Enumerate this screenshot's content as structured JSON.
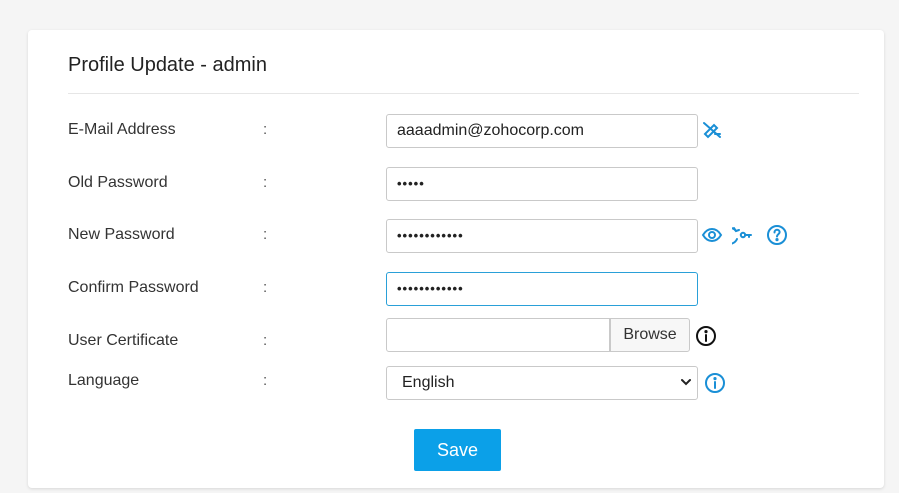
{
  "form": {
    "title": "Profile Update - admin",
    "colon": ":",
    "fields": {
      "email": {
        "label": "E-Mail Address",
        "value": "aaaadmin@zohocorp.com"
      },
      "old_password": {
        "label": "Old Password",
        "value": "•••••"
      },
      "new_password": {
        "label": "New Password",
        "value": "••••••••••••"
      },
      "confirm_password": {
        "label": "Confirm Password",
        "value": "••••••••••••"
      },
      "certificate": {
        "label": "User Certificate",
        "browse_label": "Browse"
      },
      "language": {
        "label": "Language",
        "selected": "English"
      }
    },
    "save_label": "Save"
  },
  "icons": {
    "email_action": "edit-off-icon",
    "show_password": "eye-icon",
    "generate_password": "key-icon",
    "password_help": "help-circle-icon",
    "certificate_info": "info-circle-icon",
    "language_info": "info-circle-icon"
  },
  "colors": {
    "accent": "#0ba0e8",
    "icon": "#1a8fd6",
    "focus_border": "#2aa0d8"
  }
}
